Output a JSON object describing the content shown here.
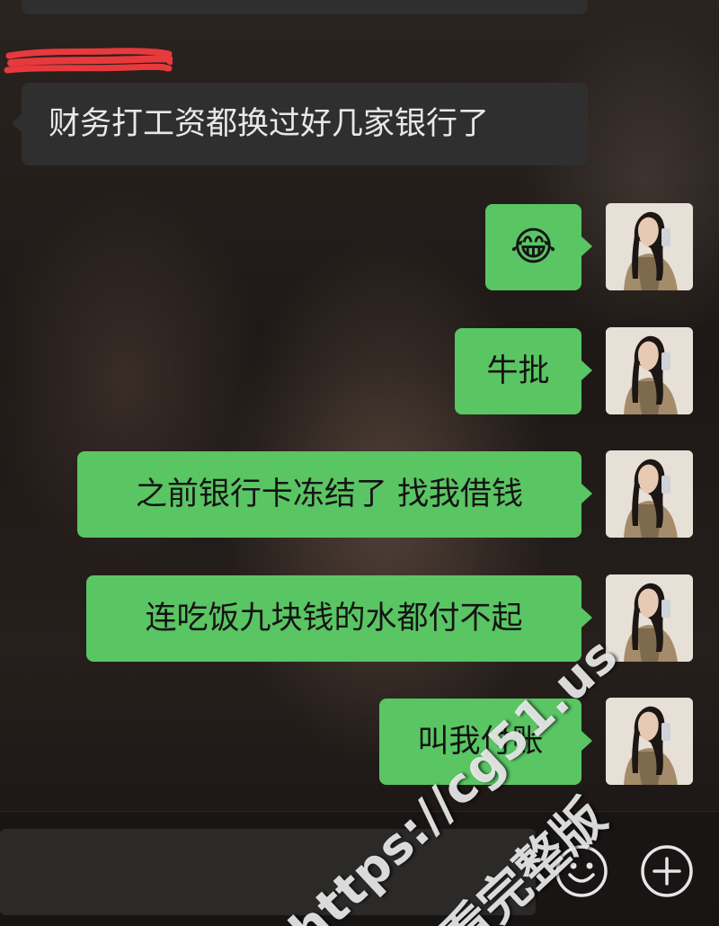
{
  "messages": [
    {
      "side": "received",
      "text": "财务打工资都换过好几家银行了"
    },
    {
      "side": "sent",
      "emoji": "😂",
      "emoji_name": "tears-of-joy-icon"
    },
    {
      "side": "sent",
      "text": "牛批"
    },
    {
      "side": "sent",
      "text": "之前银行卡冻结了 找我借钱"
    },
    {
      "side": "sent",
      "text": "连吃饭九块钱的水都付不起"
    },
    {
      "side": "sent",
      "text": "叫我付账"
    }
  ],
  "input_bar": {
    "emoji_icon": "smiley-face-icon",
    "plus_icon": "plus-circle-icon"
  },
  "watermark": {
    "url": "https://cg51.us",
    "text": "看完整版"
  },
  "colors": {
    "sent_bubble": "#5ac563",
    "received_bubble": "#2f2f2f",
    "redaction": "#e8393c"
  }
}
